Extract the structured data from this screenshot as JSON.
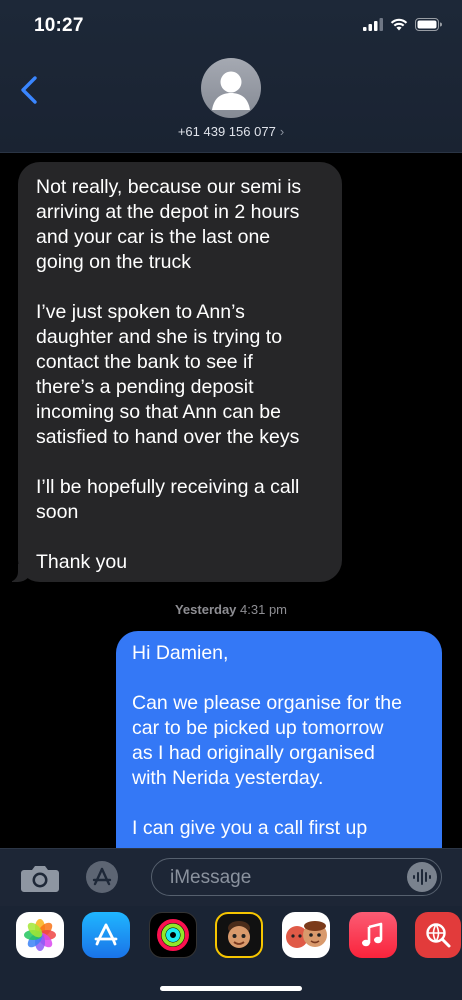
{
  "status_bar": {
    "time": "10:27"
  },
  "header": {
    "contact": "+61 439 156 077",
    "chevron": "›"
  },
  "thread": {
    "incoming": {
      "paragraphs": [
        "Not really, because our semi is\narriving at the depot in 2 hours\nand your car is the last one\ngoing on the truck",
        "I’ve just spoken to Ann’s\ndaughter and she is trying to\ncontact the bank to see if\nthere’s a pending deposit\nincoming so that Ann can be\nsatisfied to hand over the keys",
        "I’ll be hopefully receiving a call\nsoon",
        "Thank you"
      ]
    },
    "timestamp": {
      "day": "Yesterday",
      "time": "4:31 pm"
    },
    "outgoing": {
      "paragraphs": [
        "Hi Damien,",
        "Can we please organise for the\ncar to be picked up tomorrow\nas I had originally organised\nwith Nerida yesterday.",
        "I can give you a call first up"
      ]
    }
  },
  "input_bar": {
    "placeholder": "iMessage"
  },
  "icons": {
    "back": "chevron-left-icon",
    "camera": "camera-icon",
    "apps": "app-store-icon",
    "audio": "waveform-icon"
  },
  "app_drawer": [
    "Photos",
    "App Store",
    "Activity",
    "Memoji",
    "Memoji Stickers",
    "Music",
    "Web Search"
  ],
  "colors": {
    "header_bg": "#1d2838",
    "incoming_bubble": "#262628",
    "outgoing_bubble": "#3478f6",
    "accent": "#3478f6"
  }
}
